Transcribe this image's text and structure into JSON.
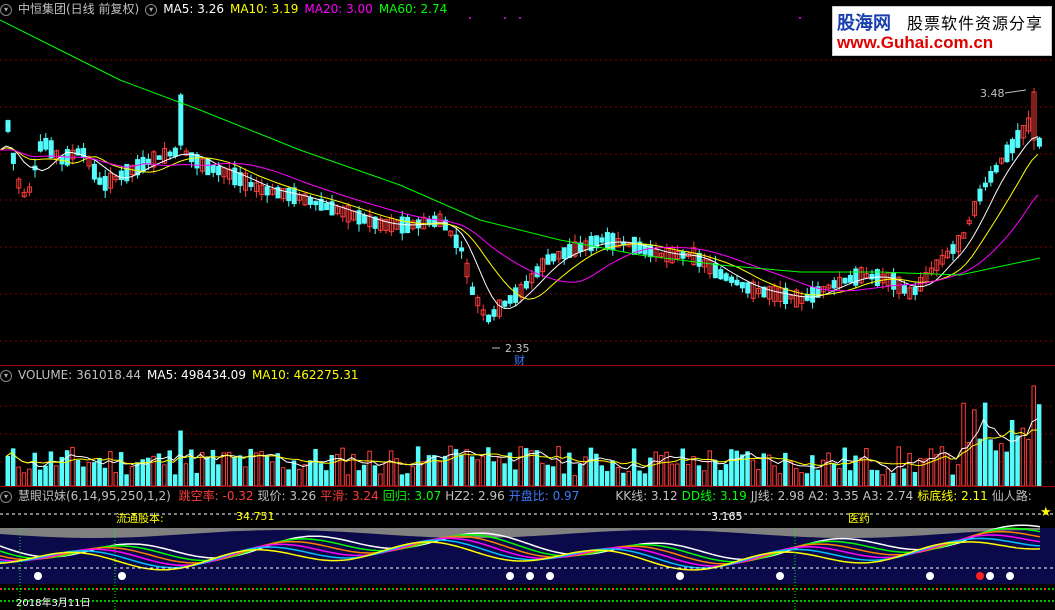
{
  "main_header": {
    "title": "中恒集团(日线 前复权)",
    "ma5": "MA5: 3.26",
    "ma10": "MA10: 3.19",
    "ma20": "MA20: 3.00",
    "ma60": "MA60: 2.74"
  },
  "price_annotations": {
    "high": "3.48",
    "low": "2.35",
    "cai": "财"
  },
  "watermark": {
    "brand": "股海网",
    "slogan": "股票软件资源分享",
    "url": "www.Guhai.com.cn"
  },
  "volume_header": {
    "title": "VOLUME: 361018.44",
    "ma5": "MA5: 498434.09",
    "ma10": "MA10: 462275.31"
  },
  "indicator_header": {
    "name": "慧眼识妹(6,14,95,250,1,2)",
    "items": [
      {
        "label": "跳空率:",
        "value": "-0.32"
      },
      {
        "label": "现价:",
        "value": "3.26"
      },
      {
        "label": "平滑:",
        "value": "3.24"
      },
      {
        "label": "回归:",
        "value": "3.07"
      },
      {
        "label": "HZ2:",
        "value": "2.96"
      },
      {
        "label": "开盘比:",
        "value": "0.97"
      },
      {
        "label": "KK线:",
        "value": "3.12"
      },
      {
        "label": "DD线:",
        "value": "3.19"
      },
      {
        "label": "JJ线:",
        "value": "2.98"
      },
      {
        "label": "A2:",
        "value": "3.35"
      },
      {
        "label": "A3:",
        "value": "2.74"
      },
      {
        "label": "标底线:",
        "value": "2.11"
      },
      {
        "label": "仙人路:",
        "value": ""
      }
    ],
    "float_label": "流通股本:",
    "float_value": "34.751",
    "mid_value": "3.165",
    "sector": "医药",
    "date_label": "2018年3月11日"
  },
  "colors": {
    "up": "#ff3c3c",
    "down": "#54fcfc",
    "ma5": "#ffffff",
    "ma10": "#ffff00",
    "ma20": "#ff00ff",
    "ma60": "#00ff00",
    "grid": "#800000"
  },
  "chart_data": {
    "type": "candlestick",
    "price_levels": {
      "high": 3.48,
      "low": 2.35,
      "ma60_last": 2.74
    },
    "volume": {
      "last": 361018.44,
      "ma5": 498434.09,
      "ma10": 462275.31
    }
  }
}
